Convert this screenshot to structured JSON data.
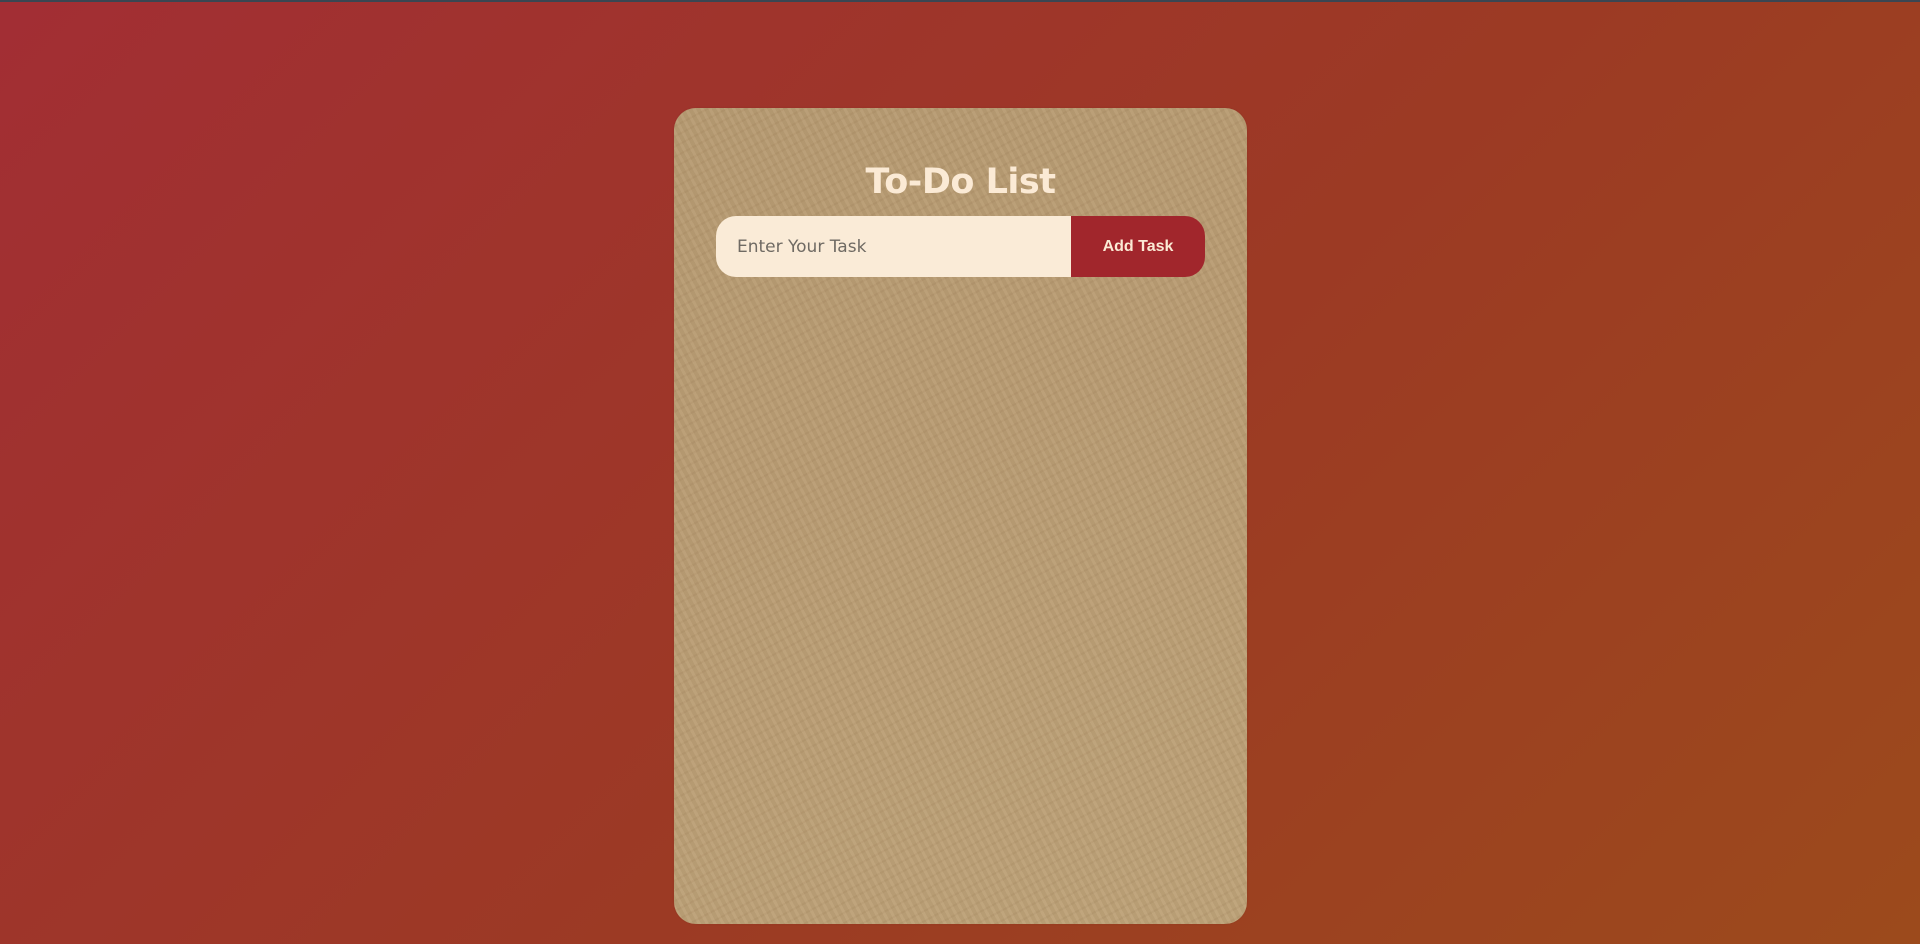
{
  "app": {
    "title": "To-Do List"
  },
  "task_form": {
    "input_value": "",
    "input_placeholder": "Enter Your Task",
    "add_button_label": "Add Task"
  },
  "tasks": [],
  "colors": {
    "background_start": "#a22e34",
    "background_end": "#9c4a1c",
    "card": "#b99b71",
    "title_text": "#fbead5",
    "input_background": "#faebd7",
    "button_background": "#a1262c",
    "button_text": "#fbead5"
  }
}
